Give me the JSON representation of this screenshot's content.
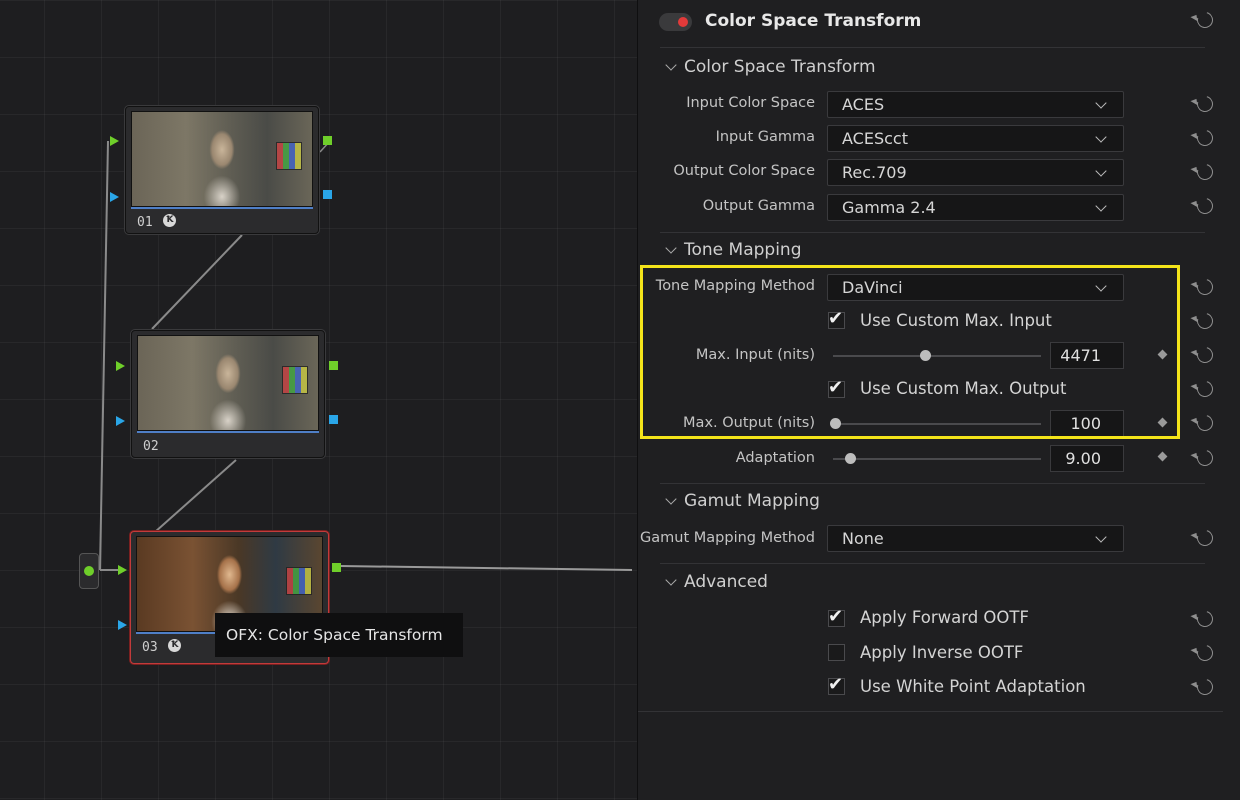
{
  "node_graph": {
    "nodes": [
      {
        "label": "01",
        "has_fx": true
      },
      {
        "label": "02",
        "has_fx": false
      },
      {
        "label": "03",
        "has_fx": true,
        "selected": true
      }
    ],
    "tooltip": "OFX: Color Space Transform",
    "colors": {
      "link_green": "#6fcf2a",
      "link_blue": "#2aa6e8",
      "selected_border": "#c23b3b"
    }
  },
  "inspector": {
    "title": "Color Space Transform",
    "enabled": true,
    "sections": {
      "cst": {
        "header": "Color Space Transform",
        "rows": [
          {
            "label": "Input Color Space",
            "value": "ACES"
          },
          {
            "label": "Input Gamma",
            "value": "ACEScct"
          },
          {
            "label": "Output Color Space",
            "value": "Rec.709"
          },
          {
            "label": "Output Gamma",
            "value": "Gamma 2.4"
          }
        ]
      },
      "tone": {
        "header": "Tone Mapping",
        "method_label": "Tone Mapping Method",
        "method_value": "DaVinci",
        "custom_input_label": "Use Custom Max. Input",
        "custom_input_checked": true,
        "max_input_label": "Max. Input (nits)",
        "max_input_value": "4471",
        "custom_output_label": "Use Custom Max. Output",
        "custom_output_checked": true,
        "max_output_label": "Max. Output (nits)",
        "max_output_value": "100",
        "adaptation_label": "Adaptation",
        "adaptation_value": "9.00"
      },
      "gamut": {
        "header": "Gamut Mapping",
        "method_label": "Gamut Mapping Method",
        "method_value": "None"
      },
      "advanced": {
        "header": "Advanced",
        "forward_ootf_label": "Apply Forward OOTF",
        "forward_ootf_checked": true,
        "inverse_ootf_label": "Apply Inverse OOTF",
        "inverse_ootf_checked": false,
        "white_point_label": "Use White Point Adaptation",
        "white_point_checked": true
      }
    },
    "highlight_color": "#f4e41a",
    "checkmark_glyph": "✔"
  }
}
